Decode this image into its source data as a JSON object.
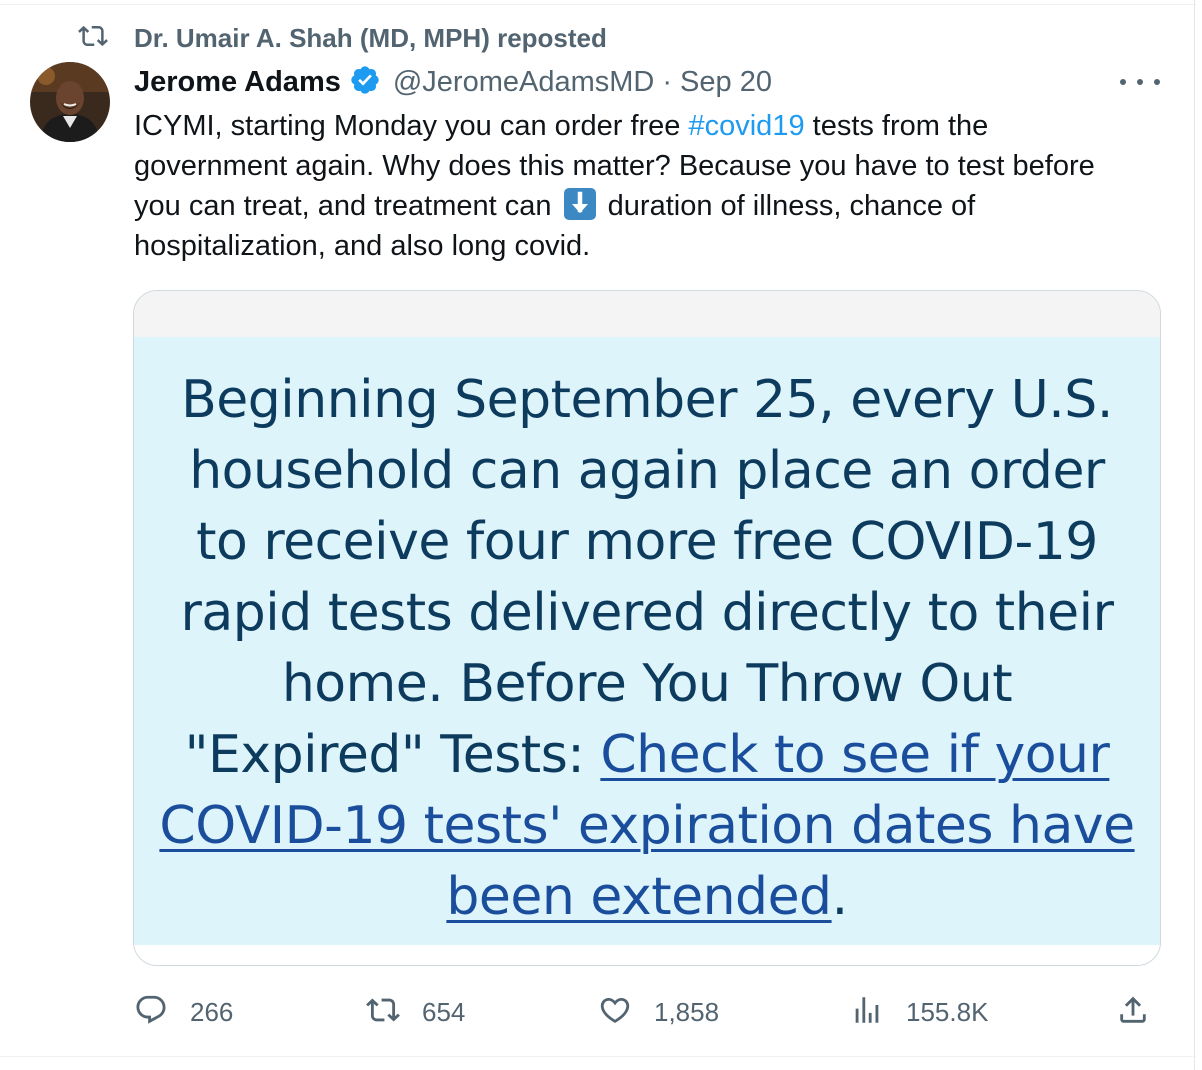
{
  "repost": {
    "icon": "repost-icon",
    "text": "Dr. Umair A. Shah (MD, MPH) reposted"
  },
  "author": {
    "name": "Jerome Adams",
    "verified_icon": "verified-badge-icon",
    "handle": "@JeromeAdamsMD",
    "separator": "·",
    "date": "Sep 20"
  },
  "tweet": {
    "lines": [
      [
        "ICYMI, starting Monday you can order free ",
        "#covid19",
        " tests from the"
      ],
      "government again. Why does this matter?  Because you have to test before",
      [
        "you can treat, and treatment can ",
        "duration of illness, chance of"
      ],
      "hospitalization, and also long covid."
    ],
    "emoji_icon": "down-arrow-emoji-icon"
  },
  "card": {
    "lines": [
      "Beginning September 25, every U.S.",
      "household can again place an order",
      "to receive four more free COVID-19",
      "rapid tests delivered directly to their",
      "home. Before You Throw Out"
    ],
    "line6_prefix": "\"Expired\" Tests: ",
    "link_lines": [
      "Check to see if your",
      "COVID-19 tests' expiration dates have",
      "been extended"
    ],
    "suffix": "."
  },
  "actions": {
    "reply_count": "266",
    "repost_count": "654",
    "like_count": "1,858",
    "views_count": "155.8K"
  },
  "colors": {
    "accent": "#1d9bf0",
    "muted": "#536471",
    "card_bg": "#def4fb",
    "card_text": "#0d3b5e",
    "card_link": "#1a4e9c"
  }
}
